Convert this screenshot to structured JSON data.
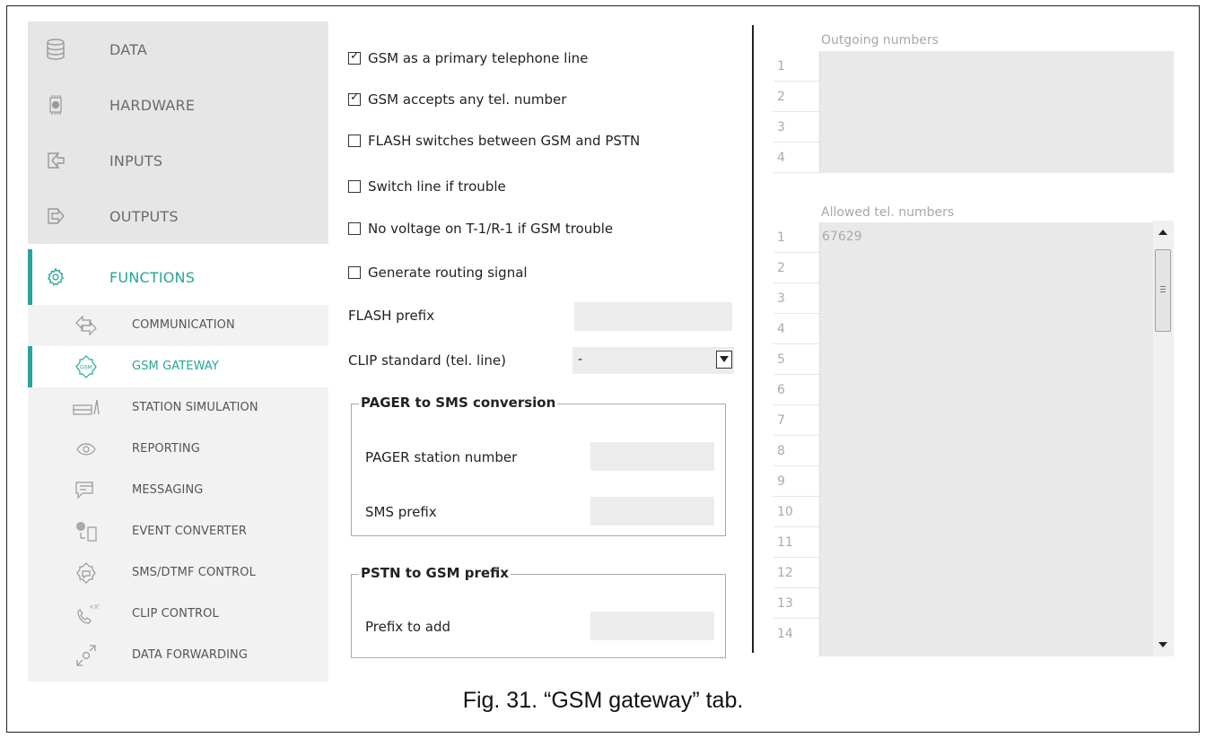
{
  "sidebar": {
    "main_items": [
      {
        "label": "DATA",
        "icon": "database-icon"
      },
      {
        "label": "HARDWARE",
        "icon": "chip-icon"
      },
      {
        "label": "INPUTS",
        "icon": "input-arrow-icon"
      },
      {
        "label": "OUTPUTS",
        "icon": "output-arrow-icon"
      },
      {
        "label": "FUNCTIONS",
        "icon": "gear-icon",
        "active": true
      }
    ],
    "sub_items": [
      {
        "label": "COMMUNICATION",
        "icon": "communication-arrows-icon"
      },
      {
        "label": "GSM GATEWAY",
        "icon": "gsm-gateway-icon",
        "active": true
      },
      {
        "label": "STATION SIMULATION",
        "icon": "station-simulation-icon"
      },
      {
        "label": "REPORTING",
        "icon": "eye-icon"
      },
      {
        "label": "MESSAGING",
        "icon": "message-icon"
      },
      {
        "label": "EVENT CONVERTER",
        "icon": "event-converter-icon"
      },
      {
        "label": "SMS/DTMF CONTROL",
        "icon": "sms-dtmf-icon"
      },
      {
        "label": "CLIP CONTROL",
        "icon": "clip-phone-icon"
      },
      {
        "label": "DATA FORWARDING",
        "icon": "data-forwarding-icon"
      }
    ]
  },
  "options": {
    "checkboxes": [
      {
        "label": "GSM as a primary telephone line",
        "checked": true
      },
      {
        "label": "GSM accepts any tel. number",
        "checked": true
      },
      {
        "label": "FLASH switches between GSM and PSTN",
        "checked": false
      },
      {
        "label": "Switch line if trouble",
        "checked": false
      },
      {
        "label": "No voltage on T-1/R-1 if GSM trouble",
        "checked": false
      },
      {
        "label": "Generate routing signal",
        "checked": false
      }
    ],
    "flash_prefix": {
      "label": "FLASH prefix",
      "value": ""
    },
    "clip_standard": {
      "label": "CLIP standard (tel. line)",
      "value": "-"
    },
    "pager_group": {
      "title": "PAGER to SMS conversion",
      "pager_station_label": "PAGER station number",
      "pager_station_value": "",
      "sms_prefix_label": "SMS prefix",
      "sms_prefix_value": ""
    },
    "pstn_group": {
      "title": "PSTN to GSM prefix",
      "prefix_label": "Prefix to add",
      "prefix_value": ""
    }
  },
  "outgoing_numbers": {
    "title": "Outgoing numbers",
    "rows": [
      {
        "index": "1",
        "value": ""
      },
      {
        "index": "2",
        "value": ""
      },
      {
        "index": "3",
        "value": ""
      },
      {
        "index": "4",
        "value": ""
      }
    ]
  },
  "allowed_numbers": {
    "title": "Allowed tel. numbers",
    "rows": [
      {
        "index": "1",
        "value": "67629"
      },
      {
        "index": "2",
        "value": ""
      },
      {
        "index": "3",
        "value": ""
      },
      {
        "index": "4",
        "value": ""
      },
      {
        "index": "5",
        "value": ""
      },
      {
        "index": "6",
        "value": ""
      },
      {
        "index": "7",
        "value": ""
      },
      {
        "index": "8",
        "value": ""
      },
      {
        "index": "9",
        "value": ""
      },
      {
        "index": "10",
        "value": ""
      },
      {
        "index": "11",
        "value": ""
      },
      {
        "index": "12",
        "value": ""
      },
      {
        "index": "13",
        "value": ""
      },
      {
        "index": "14",
        "value": ""
      }
    ]
  },
  "caption": "Fig. 31. “GSM gateway” tab.",
  "colors": {
    "accent": "#26a69a",
    "sidebar_bg": "#e6e6e6",
    "field_bg": "#ececec"
  }
}
